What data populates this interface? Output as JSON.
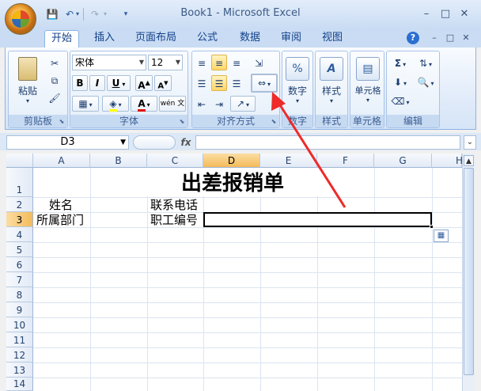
{
  "window": {
    "title": "Book1 - Microsoft Excel",
    "controls": {
      "minimize": "–",
      "restore": "□",
      "close": "✕"
    }
  },
  "qat": {
    "save": "💾",
    "undo": "↶",
    "redo": "↷",
    "customize": "▾"
  },
  "tabs": [
    {
      "label": "开始",
      "active": true
    },
    {
      "label": "插入"
    },
    {
      "label": "页面布局"
    },
    {
      "label": "公式"
    },
    {
      "label": "数据"
    },
    {
      "label": "审阅"
    },
    {
      "label": "视图"
    }
  ],
  "ribbon_right": {
    "help": "?",
    "min": "–",
    "restore": "□",
    "close": "✕"
  },
  "groups": {
    "clipboard": {
      "label": "剪贴板",
      "paste": "粘贴"
    },
    "font": {
      "label": "字体",
      "name": "宋体",
      "size": "12",
      "bold": "B",
      "italic": "I",
      "underline": "U",
      "grow": "A",
      "shrink": "A",
      "fontcolor": "A",
      "phonetic": "wén 文"
    },
    "alignment": {
      "label": "对齐方式"
    },
    "number": {
      "label": "数字",
      "symbol": "%"
    },
    "styles": {
      "label": "样式"
    },
    "cells": {
      "label": "单元格"
    },
    "editing": {
      "label": "编辑",
      "sum": "Σ"
    }
  },
  "formula_bar": {
    "name_box": "D3",
    "fx": "fx",
    "value": ""
  },
  "columns": [
    "A",
    "B",
    "C",
    "D",
    "E",
    "F",
    "G",
    "H"
  ],
  "selected_column": "D",
  "rows": [
    "1",
    "2",
    "3",
    "4",
    "5",
    "6",
    "7",
    "8",
    "9",
    "10",
    "11",
    "12",
    "13",
    "14"
  ],
  "selected_row": "3",
  "cells": {
    "title": "出差报销单",
    "a2": "姓名",
    "c2": "联系电话",
    "a3": "所属部门",
    "c3": "职工编号"
  }
}
